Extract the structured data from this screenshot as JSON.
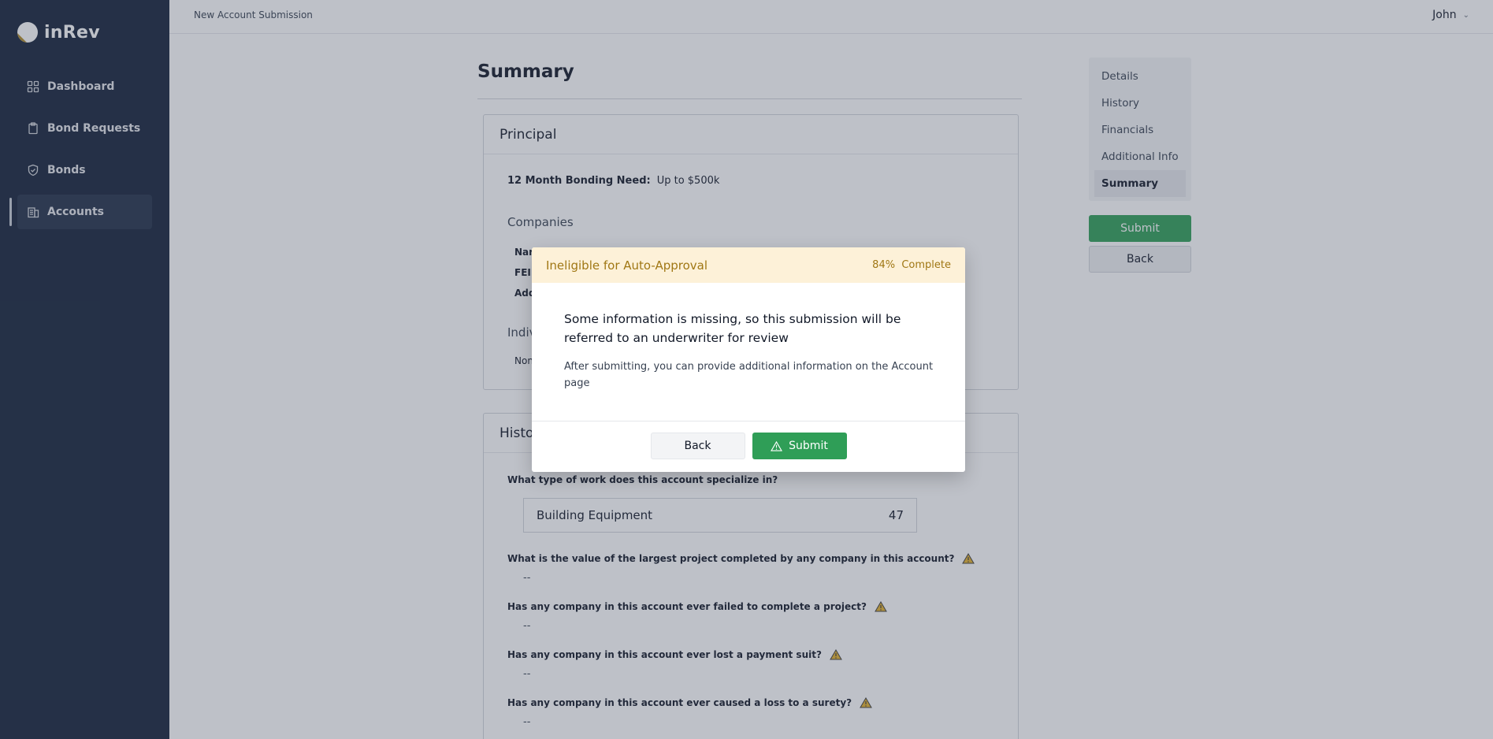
{
  "brand": {
    "name": "inRev"
  },
  "sidebar": {
    "items": [
      {
        "label": "Dashboard",
        "icon": "grid-icon"
      },
      {
        "label": "Bond Requests",
        "icon": "clipboard-icon"
      },
      {
        "label": "Bonds",
        "icon": "shield-icon"
      },
      {
        "label": "Accounts",
        "icon": "building-icon",
        "active": true
      }
    ]
  },
  "topbar": {
    "title": "New Account Submission",
    "user": "John"
  },
  "page": {
    "title": "Summary"
  },
  "principal": {
    "heading": "Principal",
    "bonding_need_label": "12 Month Bonding Need:",
    "bonding_need_value": "Up to $500k",
    "companies_heading": "Companies",
    "company_labels": [
      "Nar",
      "FEII",
      "Add"
    ],
    "individuals_heading": "Indivi",
    "individuals_value": "Non"
  },
  "history": {
    "heading": "Histor",
    "work_question": "What type of work does this account specialize in?",
    "work_value": "Building Equipment",
    "work_code": "47",
    "questions": [
      {
        "text": "What is the value of the largest project completed by any company in this account?",
        "answer": "--"
      },
      {
        "text": "Has any company in this account ever failed to complete a project?",
        "answer": "--"
      },
      {
        "text": "Has any company in this account ever lost a payment suit?",
        "answer": "--"
      },
      {
        "text": "Has any company in this account ever caused a loss to a surety?",
        "answer": "--"
      }
    ]
  },
  "steps": [
    "Details",
    "History",
    "Financials",
    "Additional Info",
    "Summary"
  ],
  "side_actions": {
    "submit": "Submit",
    "back": "Back"
  },
  "modal": {
    "title": "Ineligible for Auto-Approval",
    "percent": "84%",
    "percent_label": "Complete",
    "message": "Some information is missing, so this submission will be referred to an underwriter for review",
    "note": "After submitting, you can provide additional information on the Account page",
    "back_label": "Back",
    "submit_label": "Submit"
  },
  "colors": {
    "sidebar": "#14213a",
    "accent_green": "#2f9e57",
    "warning_bg": "#fdf1d8",
    "warning_text": "#a07714"
  }
}
